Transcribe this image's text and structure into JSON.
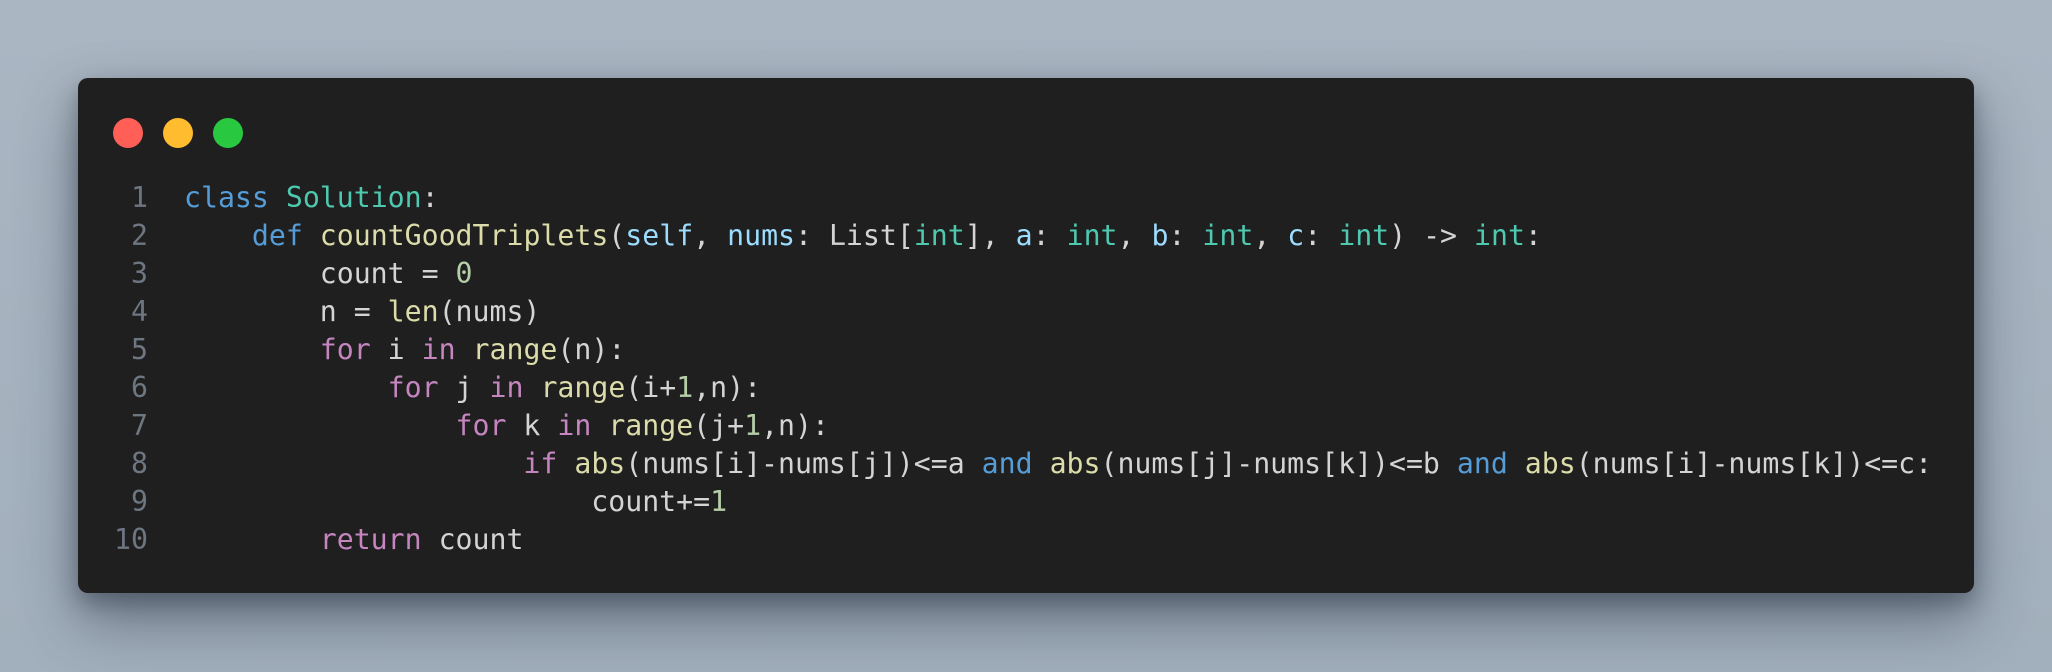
{
  "theme": {
    "background": "#a6b2bf",
    "window_bg": "#1f1f1f",
    "line_number": "#6e7681",
    "text": "#d4d4d4",
    "traffic_lights": {
      "close": "#ff5f57",
      "minimize": "#febc2e",
      "maximize": "#28c840"
    },
    "token_colors": {
      "kw": "#569cd6",
      "flow": "#c586c0",
      "cls": "#4ec9b0",
      "fn": "#dcdcaa",
      "num": "#b5cea8",
      "param": "#9cdcfe",
      "plain": "#d4d4d4"
    }
  },
  "editor": {
    "lines": [
      {
        "number": "1",
        "tokens": [
          {
            "t": "class",
            "k": "kw"
          },
          {
            "t": " ",
            "k": "plain"
          },
          {
            "t": "Solution",
            "k": "cls"
          },
          {
            "t": ":",
            "k": "plain"
          }
        ]
      },
      {
        "number": "2",
        "tokens": [
          {
            "t": "    ",
            "k": "plain"
          },
          {
            "t": "def",
            "k": "kw"
          },
          {
            "t": " ",
            "k": "plain"
          },
          {
            "t": "countGoodTriplets",
            "k": "fn"
          },
          {
            "t": "(",
            "k": "plain"
          },
          {
            "t": "self",
            "k": "param"
          },
          {
            "t": ", ",
            "k": "plain"
          },
          {
            "t": "nums",
            "k": "param"
          },
          {
            "t": ": List[",
            "k": "plain"
          },
          {
            "t": "int",
            "k": "cls"
          },
          {
            "t": "], ",
            "k": "plain"
          },
          {
            "t": "a",
            "k": "param"
          },
          {
            "t": ": ",
            "k": "plain"
          },
          {
            "t": "int",
            "k": "cls"
          },
          {
            "t": ", ",
            "k": "plain"
          },
          {
            "t": "b",
            "k": "param"
          },
          {
            "t": ": ",
            "k": "plain"
          },
          {
            "t": "int",
            "k": "cls"
          },
          {
            "t": ", ",
            "k": "plain"
          },
          {
            "t": "c",
            "k": "param"
          },
          {
            "t": ": ",
            "k": "plain"
          },
          {
            "t": "int",
            "k": "cls"
          },
          {
            "t": ") -> ",
            "k": "plain"
          },
          {
            "t": "int",
            "k": "cls"
          },
          {
            "t": ":",
            "k": "plain"
          }
        ]
      },
      {
        "number": "3",
        "tokens": [
          {
            "t": "        count = ",
            "k": "plain"
          },
          {
            "t": "0",
            "k": "num"
          }
        ]
      },
      {
        "number": "4",
        "tokens": [
          {
            "t": "        n = ",
            "k": "plain"
          },
          {
            "t": "len",
            "k": "fn"
          },
          {
            "t": "(nums)",
            "k": "plain"
          }
        ]
      },
      {
        "number": "5",
        "tokens": [
          {
            "t": "        ",
            "k": "plain"
          },
          {
            "t": "for",
            "k": "flow"
          },
          {
            "t": " i ",
            "k": "plain"
          },
          {
            "t": "in",
            "k": "flow"
          },
          {
            "t": " ",
            "k": "plain"
          },
          {
            "t": "range",
            "k": "fn"
          },
          {
            "t": "(n):",
            "k": "plain"
          }
        ]
      },
      {
        "number": "6",
        "tokens": [
          {
            "t": "            ",
            "k": "plain"
          },
          {
            "t": "for",
            "k": "flow"
          },
          {
            "t": " j ",
            "k": "plain"
          },
          {
            "t": "in",
            "k": "flow"
          },
          {
            "t": " ",
            "k": "plain"
          },
          {
            "t": "range",
            "k": "fn"
          },
          {
            "t": "(i+",
            "k": "plain"
          },
          {
            "t": "1",
            "k": "num"
          },
          {
            "t": ",n):",
            "k": "plain"
          }
        ]
      },
      {
        "number": "7",
        "tokens": [
          {
            "t": "                ",
            "k": "plain"
          },
          {
            "t": "for",
            "k": "flow"
          },
          {
            "t": " k ",
            "k": "plain"
          },
          {
            "t": "in",
            "k": "flow"
          },
          {
            "t": " ",
            "k": "plain"
          },
          {
            "t": "range",
            "k": "fn"
          },
          {
            "t": "(j+",
            "k": "plain"
          },
          {
            "t": "1",
            "k": "num"
          },
          {
            "t": ",n):",
            "k": "plain"
          }
        ]
      },
      {
        "number": "8",
        "tokens": [
          {
            "t": "                    ",
            "k": "plain"
          },
          {
            "t": "if",
            "k": "flow"
          },
          {
            "t": " ",
            "k": "plain"
          },
          {
            "t": "abs",
            "k": "fn"
          },
          {
            "t": "(nums[i]-nums[j])<=a ",
            "k": "plain"
          },
          {
            "t": "and",
            "k": "kw"
          },
          {
            "t": " ",
            "k": "plain"
          },
          {
            "t": "abs",
            "k": "fn"
          },
          {
            "t": "(nums[j]-nums[k])<=b ",
            "k": "plain"
          },
          {
            "t": "and",
            "k": "kw"
          },
          {
            "t": " ",
            "k": "plain"
          },
          {
            "t": "abs",
            "k": "fn"
          },
          {
            "t": "(nums[i]-nums[k])<=c:",
            "k": "plain"
          }
        ]
      },
      {
        "number": "9",
        "tokens": [
          {
            "t": "                        count+=",
            "k": "plain"
          },
          {
            "t": "1",
            "k": "num"
          }
        ]
      },
      {
        "number": "10",
        "tokens": [
          {
            "t": "        ",
            "k": "plain"
          },
          {
            "t": "return",
            "k": "flow"
          },
          {
            "t": " count",
            "k": "plain"
          }
        ]
      }
    ]
  }
}
